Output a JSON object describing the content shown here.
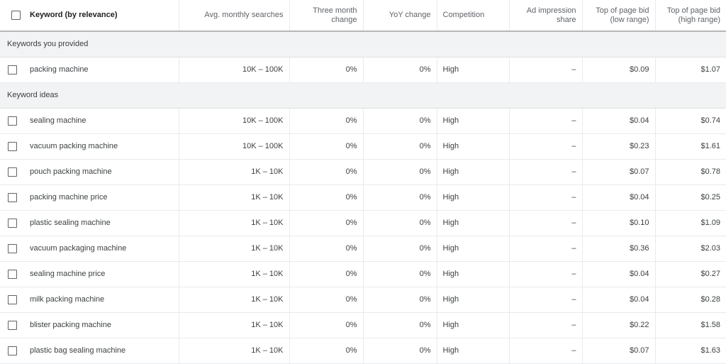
{
  "headers": {
    "keyword": "Keyword (by relevance)",
    "avg_searches": "Avg. monthly searches",
    "three_month": "Three month change",
    "yoy": "YoY change",
    "competition": "Competition",
    "ad_impression": "Ad impression share",
    "bid_low": "Top of page bid (low range)",
    "bid_high": "Top of page bid (high range)"
  },
  "groups": {
    "provided": "Keywords you provided",
    "ideas": "Keyword ideas"
  },
  "provided": [
    {
      "keyword": "packing machine",
      "avg": "10K – 100K",
      "three_month": "0%",
      "yoy": "0%",
      "competition": "High",
      "impression": "–",
      "low": "$0.09",
      "high": "$1.07"
    }
  ],
  "ideas": [
    {
      "keyword": "sealing machine",
      "avg": "10K – 100K",
      "three_month": "0%",
      "yoy": "0%",
      "competition": "High",
      "impression": "–",
      "low": "$0.04",
      "high": "$0.74"
    },
    {
      "keyword": "vacuum packing machine",
      "avg": "10K – 100K",
      "three_month": "0%",
      "yoy": "0%",
      "competition": "High",
      "impression": "–",
      "low": "$0.23",
      "high": "$1.61"
    },
    {
      "keyword": "pouch packing machine",
      "avg": "1K – 10K",
      "three_month": "0%",
      "yoy": "0%",
      "competition": "High",
      "impression": "–",
      "low": "$0.07",
      "high": "$0.78"
    },
    {
      "keyword": "packing machine price",
      "avg": "1K – 10K",
      "three_month": "0%",
      "yoy": "0%",
      "competition": "High",
      "impression": "–",
      "low": "$0.04",
      "high": "$0.25"
    },
    {
      "keyword": "plastic sealing machine",
      "avg": "1K – 10K",
      "three_month": "0%",
      "yoy": "0%",
      "competition": "High",
      "impression": "–",
      "low": "$0.10",
      "high": "$1.09"
    },
    {
      "keyword": "vacuum packaging machine",
      "avg": "1K – 10K",
      "three_month": "0%",
      "yoy": "0%",
      "competition": "High",
      "impression": "–",
      "low": "$0.36",
      "high": "$2.03"
    },
    {
      "keyword": "sealing machine price",
      "avg": "1K – 10K",
      "three_month": "0%",
      "yoy": "0%",
      "competition": "High",
      "impression": "–",
      "low": "$0.04",
      "high": "$0.27"
    },
    {
      "keyword": "milk packing machine",
      "avg": "1K – 10K",
      "three_month": "0%",
      "yoy": "0%",
      "competition": "High",
      "impression": "–",
      "low": "$0.04",
      "high": "$0.28"
    },
    {
      "keyword": "blister packing machine",
      "avg": "1K – 10K",
      "three_month": "0%",
      "yoy": "0%",
      "competition": "High",
      "impression": "–",
      "low": "$0.22",
      "high": "$1.58"
    },
    {
      "keyword": "plastic bag sealing machine",
      "avg": "1K – 10K",
      "three_month": "0%",
      "yoy": "0%",
      "competition": "High",
      "impression": "–",
      "low": "$0.07",
      "high": "$1.63"
    }
  ]
}
